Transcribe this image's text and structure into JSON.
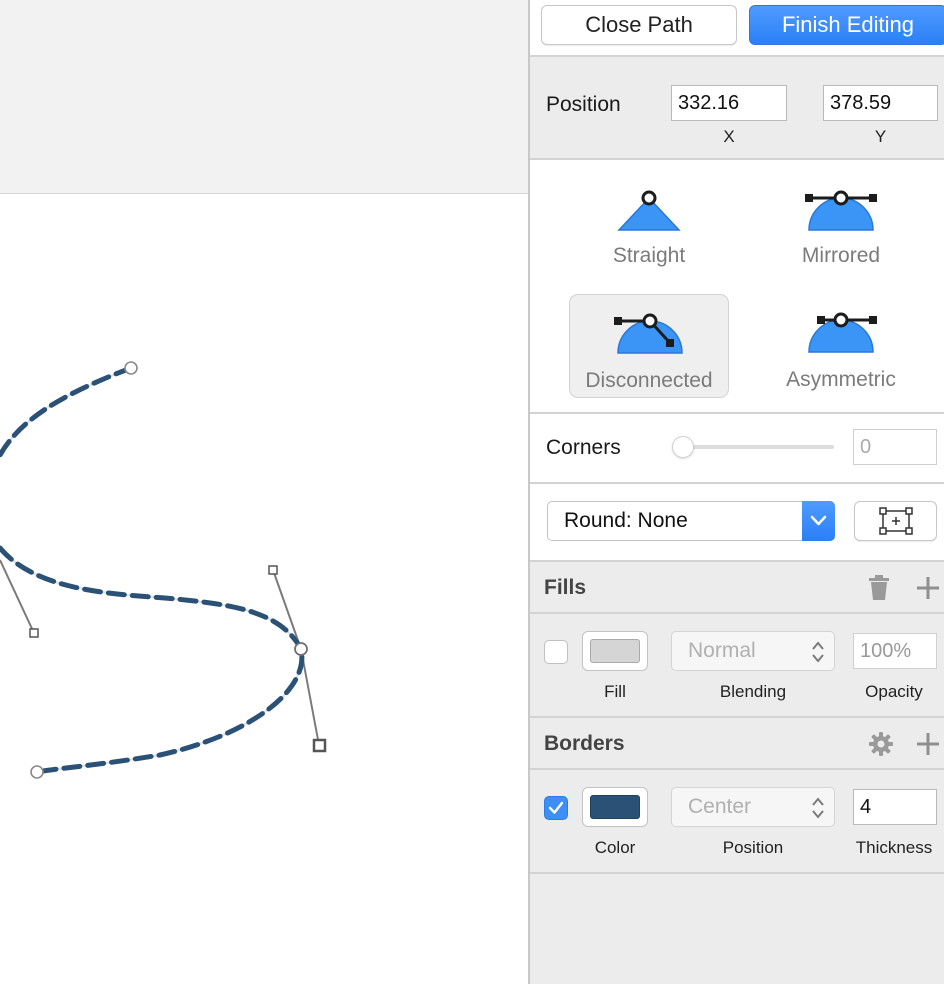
{
  "toolbar": {
    "close_path_label": "Close Path",
    "finish_editing_label": "Finish Editing"
  },
  "position": {
    "label": "Position",
    "x_value": "332.16",
    "y_value": "378.59",
    "x_caption": "X",
    "y_caption": "Y"
  },
  "point_types": [
    {
      "label": "Straight",
      "icon": "straight-point-icon",
      "active": false
    },
    {
      "label": "Mirrored",
      "icon": "mirrored-point-icon",
      "active": false
    },
    {
      "label": "Disconnected",
      "icon": "disconnected-point-icon",
      "active": true
    },
    {
      "label": "Asymmetric",
      "icon": "asymmetric-point-icon",
      "active": false
    }
  ],
  "corners": {
    "label": "Corners",
    "value": "0",
    "slider_value": 0
  },
  "round": {
    "selected": "Round: None"
  },
  "fills": {
    "header": "Fills",
    "enabled": false,
    "color": "#d5d5d5",
    "blending": "Normal",
    "opacity": "100%",
    "captions": {
      "fill": "Fill",
      "blending": "Blending",
      "opacity": "Opacity"
    }
  },
  "borders": {
    "header": "Borders",
    "enabled": true,
    "color": "#2b5276",
    "position": "Center",
    "thickness": "4",
    "captions": {
      "color": "Color",
      "position": "Position",
      "thickness": "Thickness"
    }
  },
  "colors": {
    "accent": "#2b7ff7",
    "path_stroke": "#2b5276"
  }
}
